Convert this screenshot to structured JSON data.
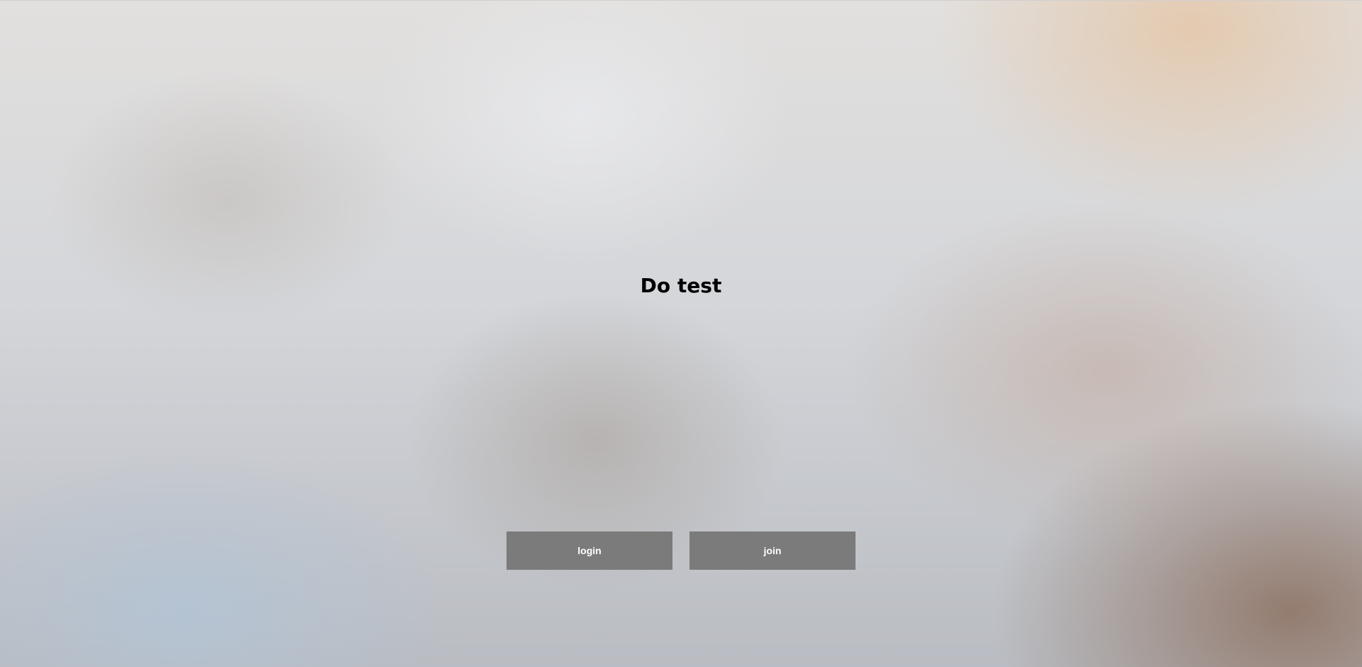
{
  "page": {
    "title": "Do test"
  },
  "actions": {
    "login_label": "login",
    "join_label": "join"
  },
  "colors": {
    "button_background": "#7b7b7b",
    "button_text": "#ffffff",
    "title_text": "#000000"
  }
}
